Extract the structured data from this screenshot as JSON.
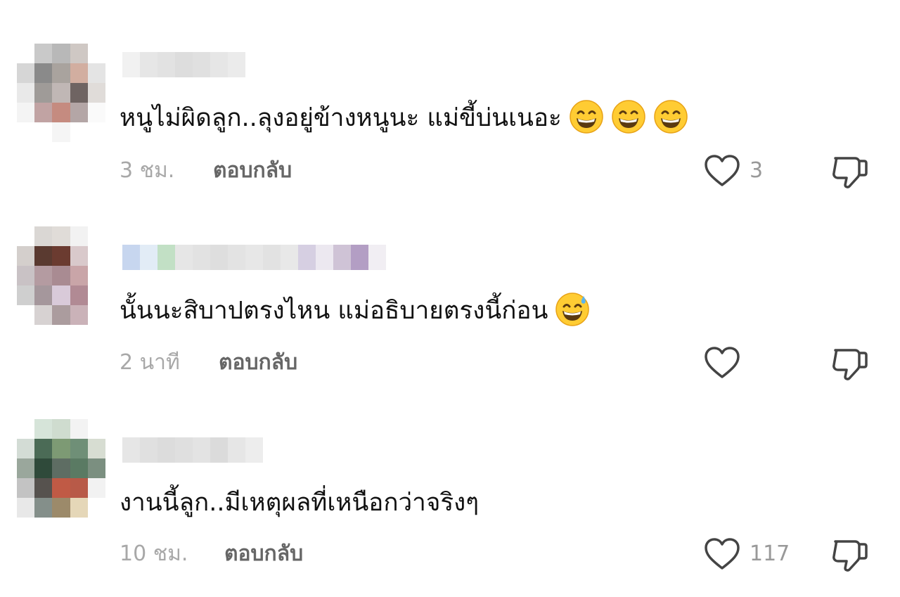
{
  "comments": [
    {
      "text": "หนูไม่ผิดลูก..ลุงอยู่ข้างหนูนะ แม่ขี้บ่นเนอะ",
      "emojis": [
        "grinning-face-with-smiling-eyes",
        "grinning-face-with-smiling-eyes",
        "grinning-face-with-smiling-eyes"
      ],
      "time": "3 ชม.",
      "reply_label": "ตอบกลับ",
      "like_count": "3"
    },
    {
      "text": "นั้นนะสิบาปตรงไหน แม่อธิบายตรงนี้ก่อน",
      "emojis": [
        "grinning-face-with-sweat"
      ],
      "time": "2 นาที",
      "reply_label": "ตอบกลับ",
      "like_count": ""
    },
    {
      "text": "งานนี้ลูก..มีเหตุผลที่เหนือกว่าจริงๆ",
      "emojis": [],
      "time": "10 ชม.",
      "reply_label": "ตอบกลับ",
      "like_count": "117"
    }
  ],
  "icons": {
    "like": "heart-outline-icon",
    "dislike": "thumbs-down-outline-icon"
  },
  "colors": {
    "text": "#111111",
    "meta": "#a8a8a8",
    "reply": "#666666",
    "icon": "#444444",
    "emoji_face": "#FFCC33"
  }
}
